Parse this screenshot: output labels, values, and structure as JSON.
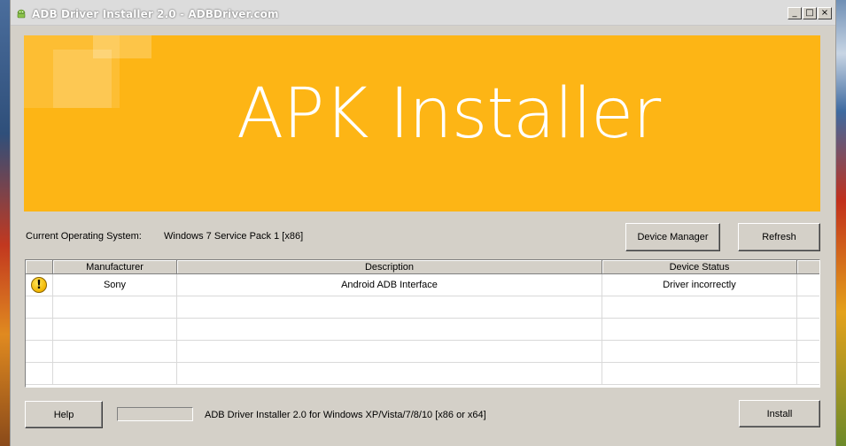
{
  "window": {
    "title": "ADB Driver Installer 2.0 - ADBDriver.com",
    "minimize": "_",
    "maximize": "□",
    "close": "×"
  },
  "banner": {
    "title": "APK Installer"
  },
  "system": {
    "os_label": "Current Operating System:",
    "os_value": "Windows 7 Service Pack 1 [x86]"
  },
  "buttons": {
    "device_manager": "Device Manager",
    "refresh": "Refresh",
    "help": "Help",
    "install": "Install"
  },
  "table": {
    "columns": [
      "",
      "Manufacturer",
      "Description",
      "Device Status",
      ""
    ],
    "rows": [
      {
        "icon": "warning-icon",
        "manufacturer": "Sony",
        "description": "Android ADB Interface",
        "status": "Driver incorrectly"
      }
    ]
  },
  "footer": {
    "progress": 0,
    "status_text": "ADB Driver Installer 2.0 for Windows XP/Vista/7/8/10 [x86 or x64]"
  },
  "colors": {
    "banner": "#fdb515",
    "window": "#d4d0c8"
  }
}
